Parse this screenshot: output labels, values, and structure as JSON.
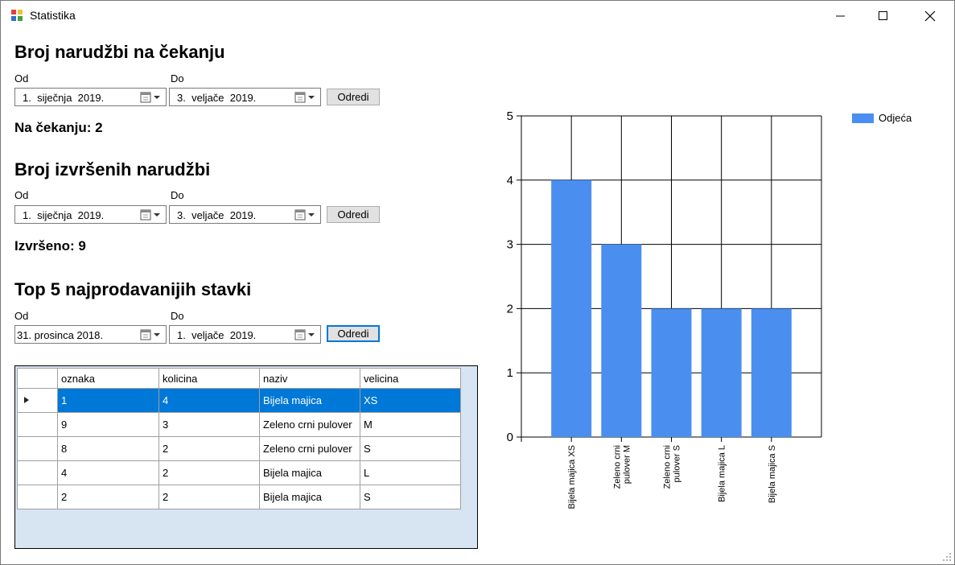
{
  "window": {
    "title": "Statistika"
  },
  "section1": {
    "title": "Broj narudžbi na čekanju",
    "from_label": "Od",
    "to_label": "Do",
    "from_value": "1.  siječnja  2019.",
    "to_value": "3.  veljače  2019.",
    "button_label": "Odredi",
    "result": "Na čekanju: 2"
  },
  "section2": {
    "title": "Broj izvršenih narudžbi",
    "from_label": "Od",
    "to_label": "Do",
    "from_value": "1.  siječnja  2019.",
    "to_value": "3.  veljače  2019.",
    "button_label": "Odredi",
    "result": "Izvršeno: 9"
  },
  "section3": {
    "title": "Top 5 najprodavanijih stavki",
    "from_label": "Od",
    "to_label": "Do",
    "from_value": "31. prosinca 2018.",
    "to_value": "1.  veljače  2019.",
    "button_label": "Odredi"
  },
  "grid": {
    "columns": [
      "oznaka",
      "kolicina",
      "naziv",
      "velicina"
    ],
    "rows": [
      [
        "1",
        "4",
        "Bijela majica",
        "XS"
      ],
      [
        "9",
        "3",
        "Zeleno crni pulover",
        "M"
      ],
      [
        "8",
        "2",
        "Zeleno crni pulover",
        "S"
      ],
      [
        "4",
        "2",
        "Bijela majica",
        "L"
      ],
      [
        "2",
        "2",
        "Bijela majica",
        "S"
      ]
    ],
    "selected_row": 0
  },
  "colors": {
    "bar": "#4a8ff0",
    "selection": "#0078d7"
  },
  "chart_data": {
    "type": "bar",
    "categories": [
      [
        "Bijela majica XS"
      ],
      [
        "Zeleno crni",
        "pulover M"
      ],
      [
        "Zeleno crni",
        "pulover S"
      ],
      [
        "Bijela majica L"
      ],
      [
        "Bijela majica S"
      ]
    ],
    "series": [
      {
        "name": "Odjeća",
        "values": [
          4,
          3,
          2,
          2,
          2
        ]
      }
    ],
    "ylim": [
      0,
      5
    ],
    "yticks": [
      0,
      1,
      2,
      3,
      4,
      5
    ],
    "grid": true,
    "legend": "top-right"
  }
}
